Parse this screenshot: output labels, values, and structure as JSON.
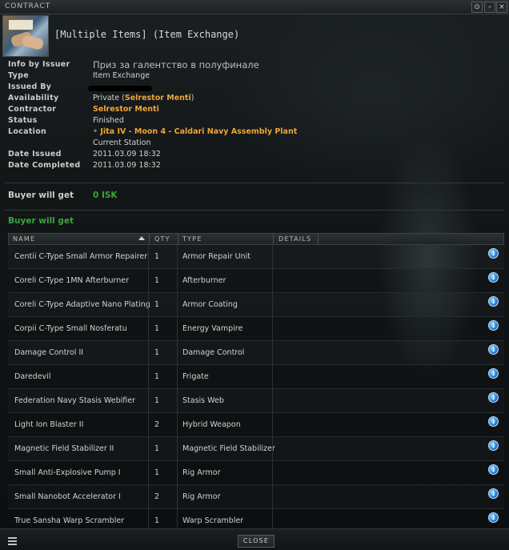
{
  "window": {
    "title": "CONTRACT",
    "heading": "[Multiple Items] (Item Exchange)",
    "minimize_glyph": "⊙",
    "close_glyph": "×"
  },
  "info": {
    "info_by_issuer_label": "Info by Issuer",
    "info_by_issuer_value": "Приз за галентство в полуфинале",
    "type_label": "Type",
    "type_value": "Item Exchange",
    "issued_by_label": "Issued By",
    "availability_label": "Availability",
    "availability_prefix": "Private (",
    "availability_name": "Selrestor Menti",
    "availability_suffix": ")",
    "contractor_label": "Contractor",
    "contractor_value": "Selrestor Menti",
    "status_label": "Status",
    "status_value": "Finished",
    "location_label": "Location",
    "location_value": "Jita IV - Moon 4 - Caldari Navy Assembly Plant",
    "location_note": "Current Station",
    "date_issued_label": "Date Issued",
    "date_issued_value": "2011.03.09 18:32",
    "date_completed_label": "Date Completed",
    "date_completed_value": "2011.03.09 18:32"
  },
  "summary": {
    "buyer_will_get_label": "Buyer will get",
    "isk_value": "0 ISK",
    "items_heading": "Buyer will get"
  },
  "table": {
    "headers": {
      "name": "NAME",
      "qty": "QTY",
      "type": "TYPE",
      "details": "DETAILS"
    },
    "rows": [
      {
        "name": "Centii C-Type Small Armor Repairer",
        "qty": "1",
        "type": "Armor Repair Unit"
      },
      {
        "name": "Coreli C-Type 1MN Afterburner",
        "qty": "1",
        "type": "Afterburner"
      },
      {
        "name": "Coreli C-Type Adaptive Nano Plating",
        "qty": "1",
        "type": "Armor Coating"
      },
      {
        "name": "Corpii C-Type Small Nosferatu",
        "qty": "1",
        "type": "Energy Vampire"
      },
      {
        "name": "Damage Control II",
        "qty": "1",
        "type": "Damage Control"
      },
      {
        "name": "Daredevil",
        "qty": "1",
        "type": "Frigate"
      },
      {
        "name": "Federation Navy Stasis Webifier",
        "qty": "1",
        "type": "Stasis Web"
      },
      {
        "name": "Light Ion Blaster II",
        "qty": "2",
        "type": "Hybrid Weapon"
      },
      {
        "name": "Magnetic Field Stabilizer II",
        "qty": "1",
        "type": "Magnetic Field Stabilizer"
      },
      {
        "name": "Small Anti-Explosive Pump I",
        "qty": "1",
        "type": "Rig Armor"
      },
      {
        "name": "Small Nanobot Accelerator I",
        "qty": "2",
        "type": "Rig Armor"
      },
      {
        "name": "True Sansha Warp Scrambler",
        "qty": "1",
        "type": "Warp Scrambler"
      }
    ],
    "info_icon_glyph": "i"
  },
  "footer": {
    "close_label": "CLOSE"
  },
  "colors": {
    "accent_orange": "#f0a437",
    "isk_green": "#3ea33e",
    "info_blue": "#1f73c9"
  }
}
